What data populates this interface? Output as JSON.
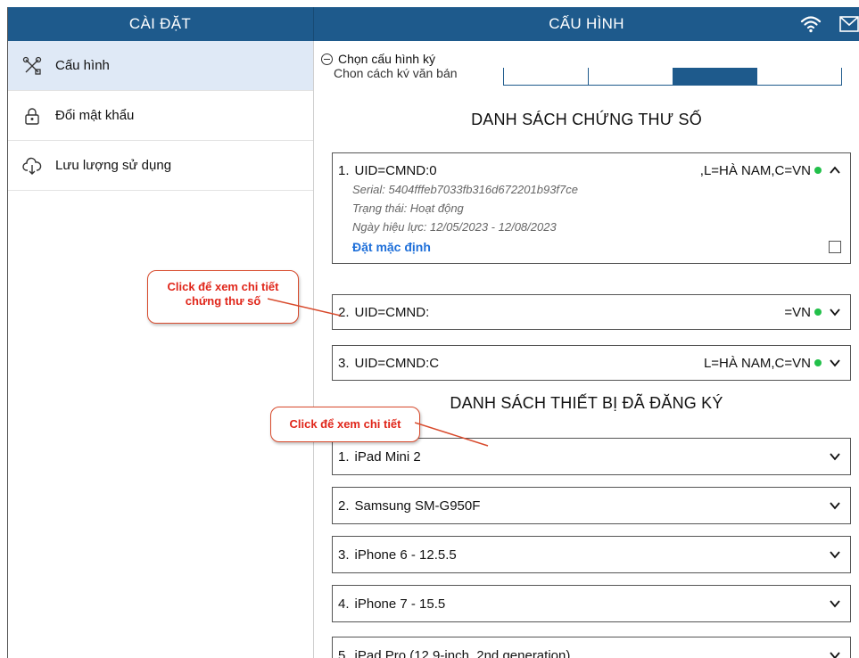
{
  "sidebar_header": {
    "title": "CÀI ĐẶT"
  },
  "main_header": {
    "title": "CẤU HÌNH",
    "icons": [
      "wifi-icon",
      "mail-icon"
    ]
  },
  "sidebar": {
    "items": [
      {
        "label": "Cấu hình",
        "icon": "tools-icon",
        "active": true
      },
      {
        "label": "Đổi mật khẩu",
        "icon": "lock-icon",
        "active": false
      },
      {
        "label": "Lưu lượng sử dụng",
        "icon": "cloud-download-icon",
        "active": false
      }
    ]
  },
  "config": {
    "toggle_label": "Chọn cấu hình ký",
    "sub_label": "Chọn cách ký văn bản",
    "segments": 4,
    "selected_segment": 3
  },
  "certificates": {
    "title": "DANH SÁCH CHỨNG THƯ SỐ",
    "items": [
      {
        "num": "1.",
        "uid": "UID=CMND:0",
        "location": ",L=HÀ NAM,C=VN",
        "expanded": true,
        "serial": "Serial: 5404fffeb7033fb316d672201b93f7ce",
        "status": "Trạng thái: Hoạt động",
        "validity": "Ngày hiệu lực: 12/05/2023 - 12/08/2023",
        "default_link": "Đặt mặc định"
      },
      {
        "num": "2.",
        "uid": "UID=CMND:",
        "location": "=VN",
        "expanded": false
      },
      {
        "num": "3.",
        "uid": "UID=CMND:C",
        "location": "L=HÀ NAM,C=VN",
        "expanded": false
      }
    ]
  },
  "devices": {
    "title": "DANH SÁCH THIẾT BỊ ĐÃ ĐĂNG KÝ",
    "items": [
      {
        "num": "1.",
        "name": "iPad Mini 2"
      },
      {
        "num": "2.",
        "name": "Samsung SM-G950F"
      },
      {
        "num": "3.",
        "name": "iPhone 6 - 12.5.5"
      },
      {
        "num": "4.",
        "name": "iPhone 7 - 15.5"
      },
      {
        "num": "5.",
        "name": "iPad Pro (12.9-inch, 2nd generation)"
      }
    ]
  },
  "callouts": {
    "cert_detail": "Click để xem chi tiết chứng thư số",
    "device_detail": "Click để xem chi tiết"
  },
  "colors": {
    "header": "#1e5a8c",
    "active_item": "#dfe9f6",
    "status_dot": "#22c04a",
    "link": "#1e6fd9",
    "callout_text": "#e0261a",
    "callout_border": "#d84a2c"
  }
}
